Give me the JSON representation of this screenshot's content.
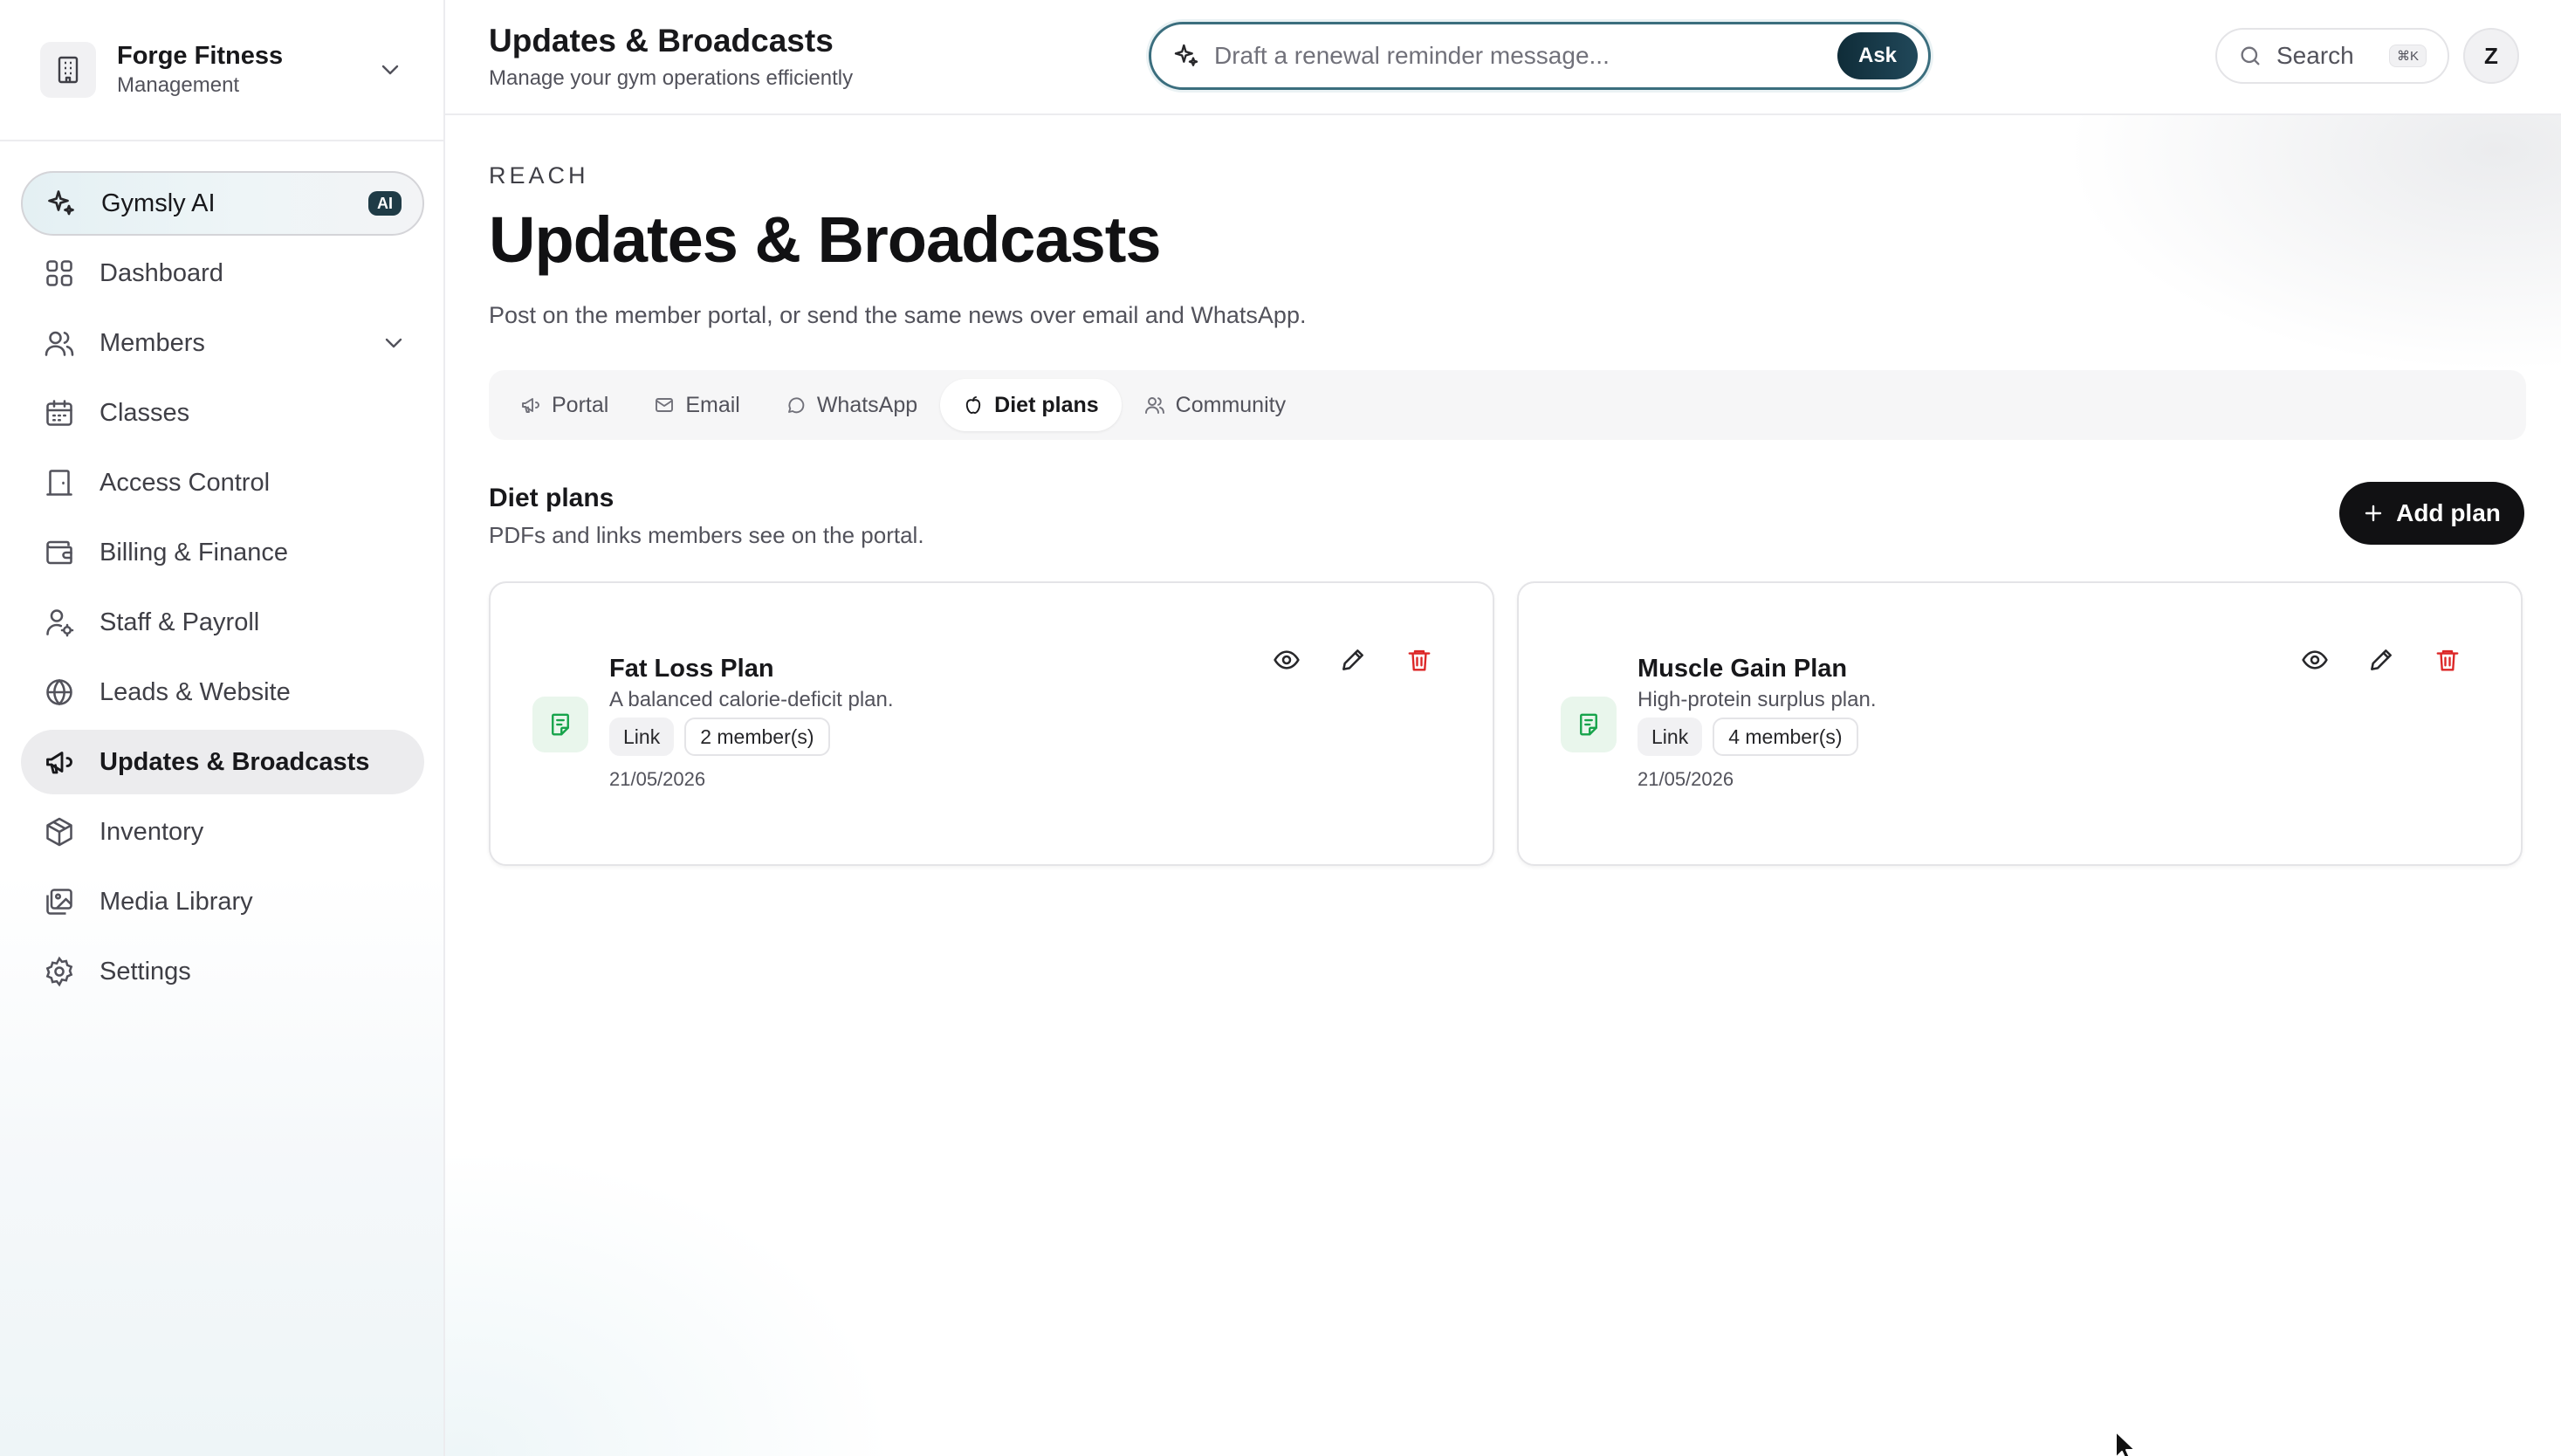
{
  "org": {
    "name": "Forge Fitness",
    "role": "Management"
  },
  "sidebar": {
    "items": [
      {
        "label": "Gymsly AI",
        "badge": "AI",
        "icon": "sparkles-icon"
      },
      {
        "label": "Dashboard",
        "icon": "grid-icon"
      },
      {
        "label": "Members",
        "icon": "users-icon"
      },
      {
        "label": "Classes",
        "icon": "calendar-icon"
      },
      {
        "label": "Access Control",
        "icon": "door-icon"
      },
      {
        "label": "Billing & Finance",
        "icon": "wallet-icon"
      },
      {
        "label": "Staff & Payroll",
        "icon": "user-cog-icon"
      },
      {
        "label": "Leads & Website",
        "icon": "globe-icon"
      },
      {
        "label": "Updates & Broadcasts",
        "icon": "megaphone-icon",
        "active": true
      },
      {
        "label": "Inventory",
        "icon": "box-icon"
      },
      {
        "label": "Media Library",
        "icon": "images-icon"
      },
      {
        "label": "Settings",
        "icon": "gear-icon"
      }
    ]
  },
  "header": {
    "title": "Updates & Broadcasts",
    "subtitle": "Manage your gym operations efficiently",
    "ask_placeholder": "Draft a renewal reminder message...",
    "ask_label": "Ask",
    "search_label": "Search",
    "search_shortcut": "⌘K",
    "avatar_initial": "Z"
  },
  "page": {
    "eyebrow": "REACH",
    "title": "Updates & Broadcasts",
    "lead": "Post on the member portal, or send the same news over email and WhatsApp."
  },
  "tabs": [
    {
      "label": "Portal",
      "icon": "megaphone-icon"
    },
    {
      "label": "Email",
      "icon": "mail-icon"
    },
    {
      "label": "WhatsApp",
      "icon": "chat-bubble-icon"
    },
    {
      "label": "Diet plans",
      "icon": "apple-icon",
      "active": true
    },
    {
      "label": "Community",
      "icon": "users-icon"
    }
  ],
  "section": {
    "title": "Diet plans",
    "subtitle": "PDFs and links members see on the portal.",
    "add_label": "Add plan"
  },
  "plans": [
    {
      "title": "Fat Loss Plan",
      "description": "A balanced calorie-deficit plan.",
      "type": "Link",
      "members": "2 member(s)",
      "date": "21/05/2026"
    },
    {
      "title": "Muscle Gain Plan",
      "description": "High-protein surplus plan.",
      "type": "Link",
      "members": "4 member(s)",
      "date": "21/05/2026"
    }
  ],
  "colors": {
    "accent": "#1f3b46",
    "danger": "#dc2626",
    "doc_icon": "#16a34a",
    "primary_button": "#111113"
  }
}
